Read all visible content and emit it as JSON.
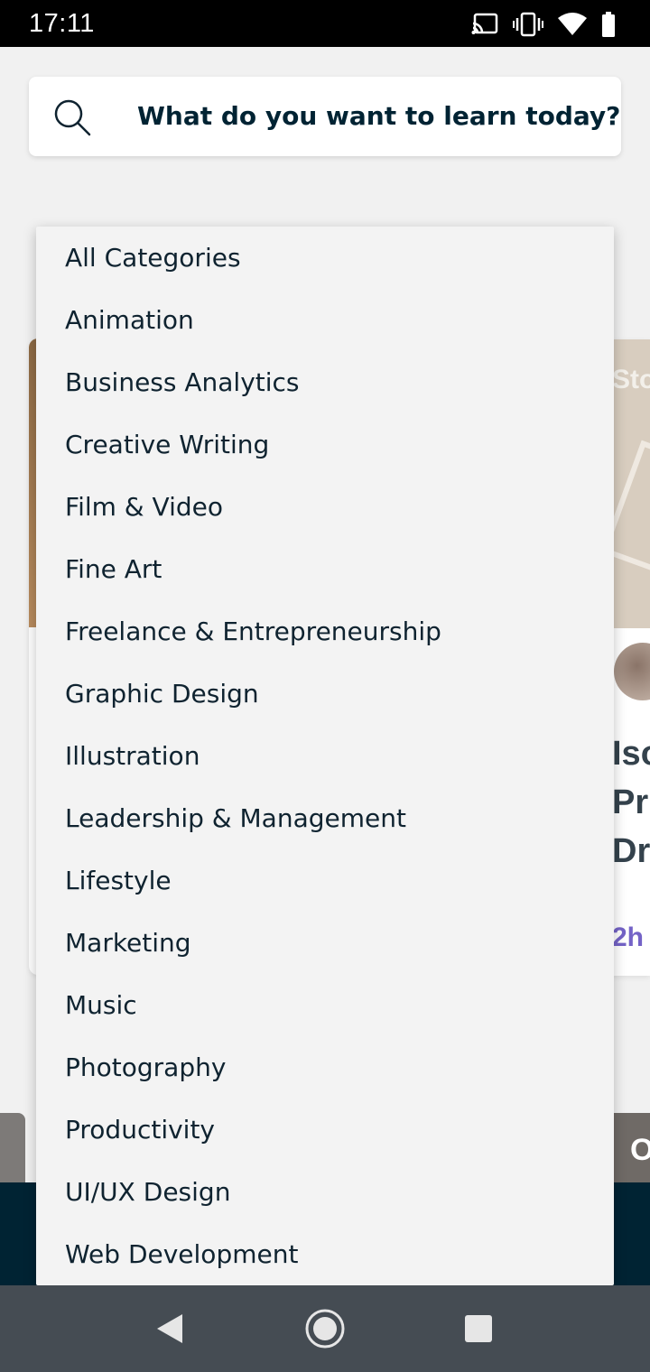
{
  "status_bar": {
    "time": "17:11",
    "icons": [
      "cast-icon",
      "vibrate-icon",
      "wifi-icon",
      "battery-icon"
    ]
  },
  "search": {
    "placeholder": "What do you want to learn today?",
    "icon": "search-icon"
  },
  "background": {
    "right_card": {
      "thumb_text": "Sto",
      "title_lines": [
        "Iso",
        "Pr",
        "Dr"
      ],
      "duration": "2h"
    },
    "row2_right_text": "O"
  },
  "category_menu": {
    "items": [
      "All Categories",
      "Animation",
      "Business Analytics",
      "Creative Writing",
      "Film & Video",
      "Fine Art",
      "Freelance & Entrepreneurship",
      "Graphic Design",
      "Illustration",
      "Leadership & Management",
      "Lifestyle",
      "Marketing",
      "Music",
      "Photography",
      "Productivity",
      "UI/UX Design",
      "Web Development"
    ]
  },
  "nav_bar": {
    "buttons": [
      "back-icon",
      "home-icon",
      "recent-apps-icon"
    ]
  },
  "colors": {
    "text_dark": "#002333",
    "accent_purple": "#7463c7",
    "menu_bg": "#f3f3f3",
    "nav_bg": "#454c53"
  }
}
